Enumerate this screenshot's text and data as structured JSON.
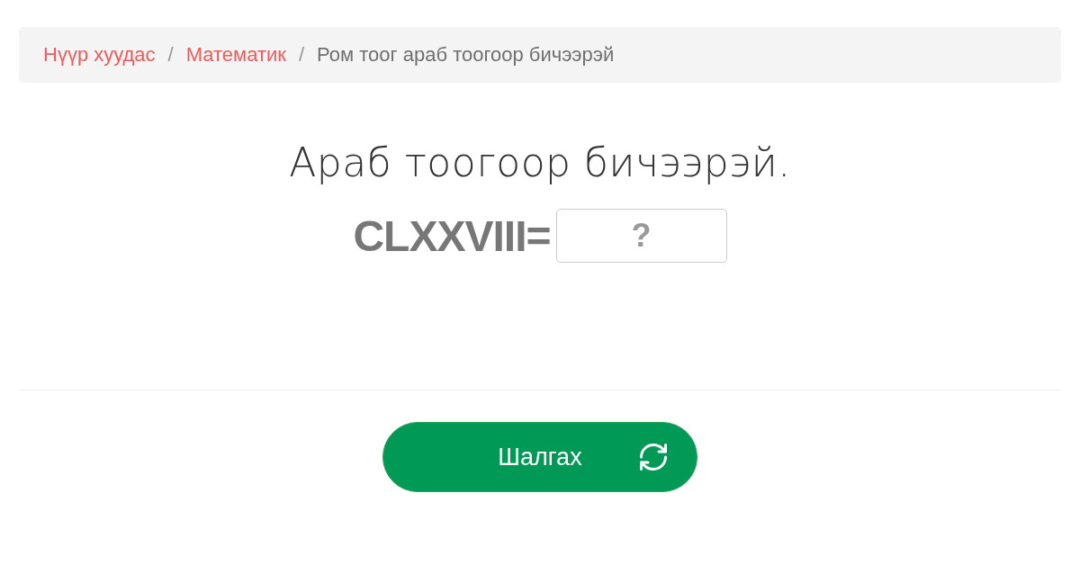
{
  "breadcrumb": {
    "separator": "/",
    "items": [
      {
        "label": "Нүүр хуудас",
        "kind": "link"
      },
      {
        "label": "Математик",
        "kind": "link"
      },
      {
        "label": "Ром тоог араб тоогоор бичээрэй",
        "kind": "current"
      }
    ]
  },
  "question": {
    "title": "Араб тоогоор бичээрэй.",
    "expression": "CLXXVIII=",
    "answer": {
      "placeholder": "?"
    }
  },
  "button": {
    "label": "Шалгах"
  }
}
